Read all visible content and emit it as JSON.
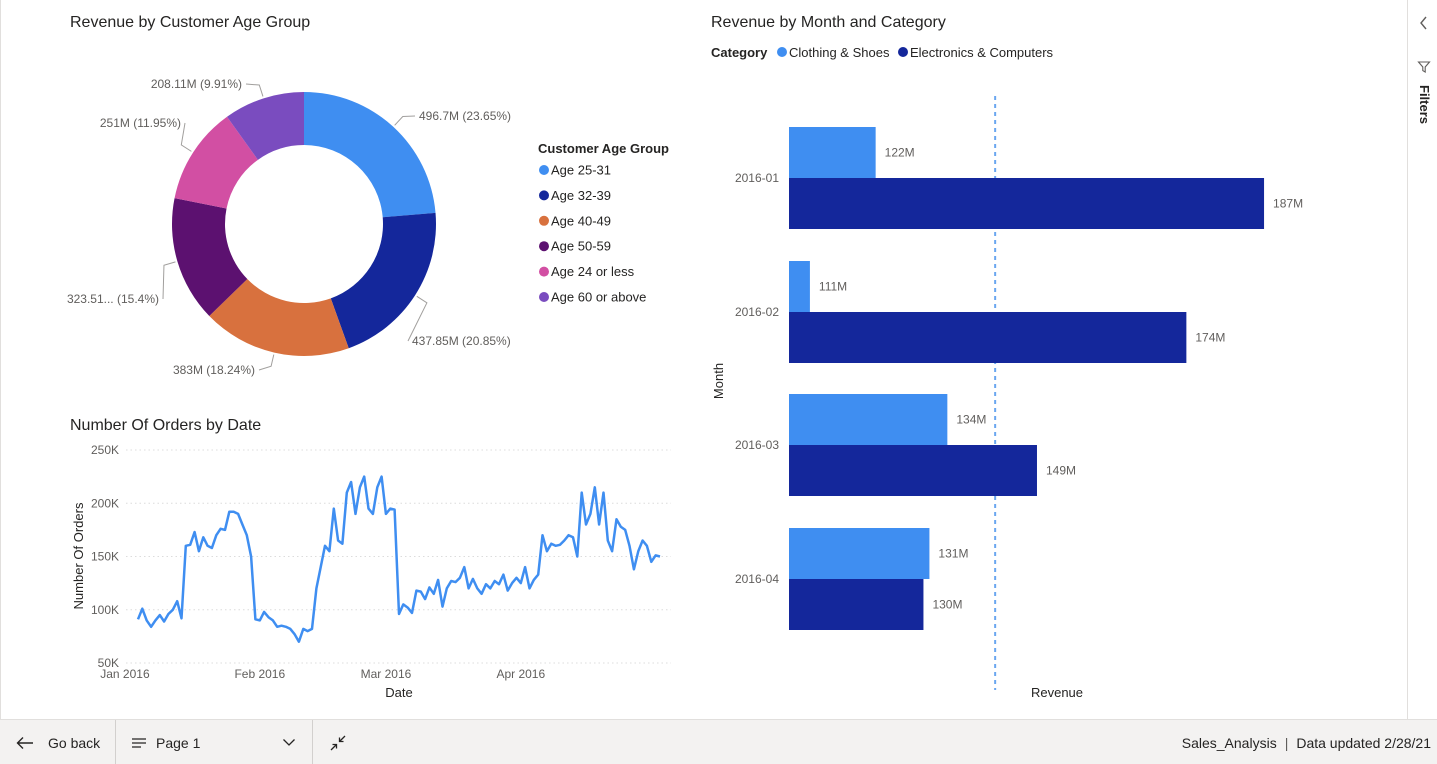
{
  "donut": {
    "title": "Revenue by Customer Age Group",
    "legend_title": "Customer Age Group",
    "slices": [
      {
        "name": "Age 25-31",
        "value": 496.7,
        "label": "496.7M (23.65%)",
        "color": "#3f8ef1"
      },
      {
        "name": "Age 32-39",
        "value": 437.85,
        "label": "437.85M (20.85%)",
        "color": "#14279b"
      },
      {
        "name": "Age 40-49",
        "value": 383,
        "label": "383M (18.24%)",
        "color": "#d8713e"
      },
      {
        "name": "Age 50-59",
        "value": 323.51,
        "label": "323.51... (15.4%)",
        "color": "#5c1170"
      },
      {
        "name": "Age 24 or less",
        "value": 251,
        "label": "251M (11.95%)",
        "color": "#d24fa3"
      },
      {
        "name": "Age 60 or above",
        "value": 208.11,
        "label": "208.11M (9.91%)",
        "color": "#7a4cbf"
      }
    ]
  },
  "orders": {
    "title": "Number Of Orders by Date",
    "ylabel": "Number Of Orders",
    "xlabel": "Date",
    "yticks": [
      {
        "v": 50000,
        "t": "50K"
      },
      {
        "v": 100000,
        "t": "100K"
      },
      {
        "v": 150000,
        "t": "150K"
      },
      {
        "v": 200000,
        "t": "200K"
      },
      {
        "v": 250000,
        "t": "250K"
      }
    ],
    "xticks": [
      {
        "d": 0,
        "t": "Jan 2016"
      },
      {
        "d": 31,
        "t": "Feb 2016"
      },
      {
        "d": 60,
        "t": "Mar 2016"
      },
      {
        "d": 91,
        "t": "Apr 2016"
      }
    ],
    "color": "#3f8ef1"
  },
  "bars": {
    "title": "Revenue by Month and Category",
    "legend_label": "Category",
    "ylabel": "Month",
    "xlabel": "Revenue",
    "series": [
      {
        "name": "Clothing & Shoes",
        "color": "#3f8ef1"
      },
      {
        "name": "Electronics & Computers",
        "color": "#14279b"
      }
    ],
    "ref_color": "#6aa6f0"
  },
  "filters": {
    "label": "Filters"
  },
  "bottom": {
    "go_back": "Go back",
    "page": "Page 1",
    "report_name": "Sales_Analysis",
    "separator": "|",
    "updated": "Data updated 2/28/21"
  },
  "chart_data": [
    {
      "type": "pie",
      "title": "Revenue by Customer Age Group",
      "legend_title": "Customer Age Group",
      "categories": [
        "Age 25-31",
        "Age 32-39",
        "Age 40-49",
        "Age 50-59",
        "Age 24 or less",
        "Age 60 or above"
      ],
      "values": [
        496.7,
        437.85,
        383,
        323.51,
        251,
        208.11
      ],
      "unit": "M",
      "legend": "right"
    },
    {
      "type": "line",
      "title": "Number Of Orders by Date",
      "xlabel": "Date",
      "ylabel": "Number Of Orders",
      "x": [
        "2016-01-04",
        "2016-01-05",
        "2016-01-06",
        "2016-01-07",
        "2016-01-08",
        "2016-01-09",
        "2016-01-10",
        "2016-01-11",
        "2016-01-12",
        "2016-01-13",
        "2016-01-14",
        "2016-01-15",
        "2016-01-16",
        "2016-01-17",
        "2016-01-18",
        "2016-01-19",
        "2016-01-20",
        "2016-01-21",
        "2016-01-22",
        "2016-01-23",
        "2016-01-24",
        "2016-01-25",
        "2016-01-26",
        "2016-01-27",
        "2016-01-28",
        "2016-01-29",
        "2016-01-30",
        "2016-01-31",
        "2016-02-01",
        "2016-02-02",
        "2016-02-03",
        "2016-02-04",
        "2016-02-05",
        "2016-02-06",
        "2016-02-07",
        "2016-02-08",
        "2016-02-09",
        "2016-02-10",
        "2016-02-11",
        "2016-02-12",
        "2016-02-13",
        "2016-02-14",
        "2016-02-15",
        "2016-02-16",
        "2016-02-17",
        "2016-02-18",
        "2016-02-19",
        "2016-02-20",
        "2016-02-21",
        "2016-02-22",
        "2016-02-23",
        "2016-02-24",
        "2016-02-25",
        "2016-02-26",
        "2016-02-27",
        "2016-02-28",
        "2016-02-29",
        "2016-03-01",
        "2016-03-02",
        "2016-03-03",
        "2016-03-04",
        "2016-03-05",
        "2016-03-06",
        "2016-03-07",
        "2016-03-08",
        "2016-03-09",
        "2016-03-10",
        "2016-03-11",
        "2016-03-12",
        "2016-03-13",
        "2016-03-14",
        "2016-03-15",
        "2016-03-16",
        "2016-03-17",
        "2016-03-18",
        "2016-03-19",
        "2016-03-20",
        "2016-03-21",
        "2016-03-22",
        "2016-03-23",
        "2016-03-24",
        "2016-03-25",
        "2016-03-26",
        "2016-03-27",
        "2016-03-28",
        "2016-03-29",
        "2016-03-30",
        "2016-03-31",
        "2016-04-01",
        "2016-04-02",
        "2016-04-03",
        "2016-04-04",
        "2016-04-05",
        "2016-04-06",
        "2016-04-07",
        "2016-04-08",
        "2016-04-09",
        "2016-04-10",
        "2016-04-11",
        "2016-04-12",
        "2016-04-13",
        "2016-04-14",
        "2016-04-15",
        "2016-04-16",
        "2016-04-17",
        "2016-04-18",
        "2016-04-19",
        "2016-04-20",
        "2016-04-21",
        "2016-04-22",
        "2016-04-23",
        "2016-04-24",
        "2016-04-25",
        "2016-04-26",
        "2016-04-27",
        "2016-04-28",
        "2016-04-29",
        "2016-04-30",
        "2016-05-01",
        "2016-05-02",
        "2016-05-03",
        "2016-05-04"
      ],
      "y": [
        91000,
        101000,
        90000,
        84000,
        90000,
        95000,
        89000,
        96000,
        100000,
        108000,
        92000,
        160000,
        161000,
        173000,
        155000,
        168000,
        160000,
        158000,
        170000,
        176000,
        175000,
        192000,
        192000,
        190000,
        180000,
        170000,
        150000,
        91000,
        90000,
        98000,
        93000,
        90000,
        84000,
        85000,
        84000,
        82000,
        77000,
        70000,
        82000,
        80000,
        82000,
        120000,
        140000,
        160000,
        155000,
        195000,
        165000,
        162000,
        210000,
        220000,
        190000,
        215000,
        225000,
        195000,
        190000,
        215000,
        225000,
        190000,
        195000,
        194000,
        96000,
        105000,
        102000,
        97000,
        118000,
        117000,
        110000,
        121000,
        115000,
        128000,
        103000,
        120000,
        127000,
        126000,
        130000,
        140000,
        120000,
        129000,
        120000,
        115000,
        124000,
        120000,
        127000,
        124000,
        133000,
        118000,
        125000,
        130000,
        125000,
        140000,
        120000,
        128000,
        133000,
        170000,
        155000,
        162000,
        160000,
        161000,
        165000,
        170000,
        168000,
        150000,
        210000,
        180000,
        190000,
        215000,
        180000,
        210000,
        165000,
        155000,
        185000,
        178000,
        175000,
        160000,
        138000,
        155000,
        165000,
        160000,
        145000,
        151000,
        150000
      ],
      "ylim": [
        50000,
        250000
      ],
      "yticks": [
        "50K",
        "100K",
        "150K",
        "200K",
        "250K"
      ],
      "xticks": [
        "Jan 2016",
        "Feb 2016",
        "Mar 2016",
        "Apr 2016"
      ],
      "grid": true
    },
    {
      "type": "bar",
      "orientation": "horizontal",
      "title": "Revenue by Month and Category",
      "ylabel": "Month",
      "xlabel": "Revenue",
      "legend_title": "Category",
      "legend": "top-left",
      "categories": [
        "2016-01",
        "2016-02",
        "2016-03",
        "2016-04"
      ],
      "series": [
        {
          "name": "Clothing & Shoes",
          "values": [
            122,
            111,
            134,
            131
          ],
          "labels": [
            "122M",
            "111M",
            "134M",
            "131M"
          ]
        },
        {
          "name": "Electronics & Computers",
          "values": [
            187,
            174,
            149,
            130
          ],
          "labels": [
            "187M",
            "174M",
            "149M",
            "130M"
          ]
        }
      ],
      "unit": "M",
      "xlim": [
        107.5,
        189
      ],
      "reference_line": 142
    }
  ]
}
